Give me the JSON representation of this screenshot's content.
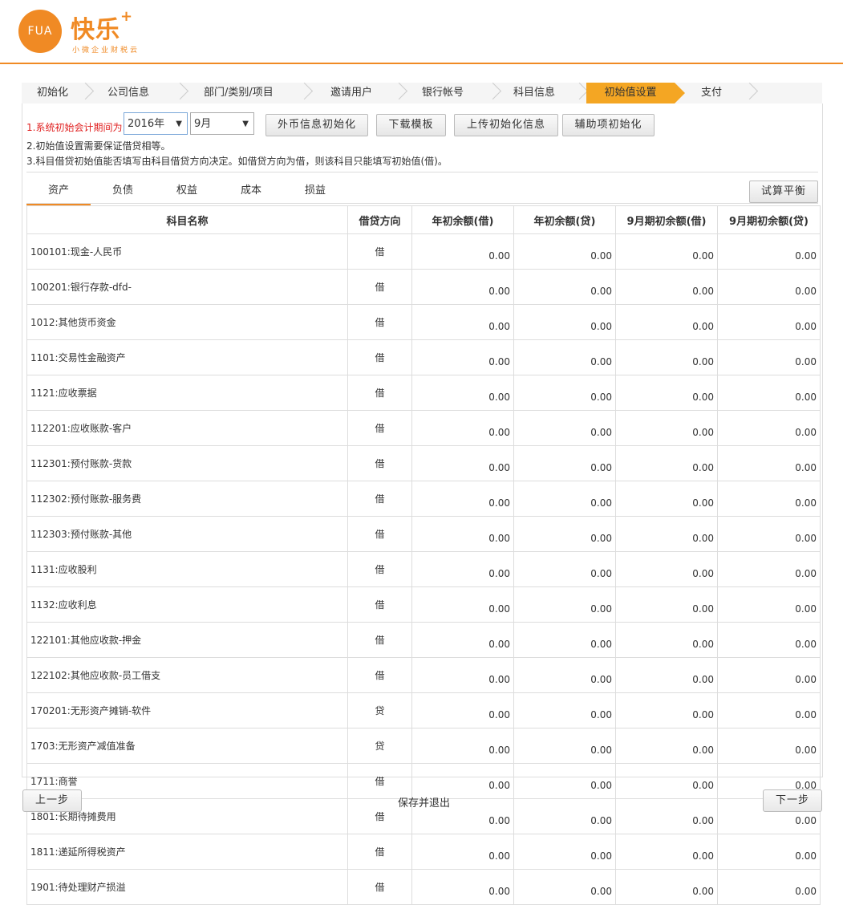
{
  "logo": {
    "circle_text": "FUA",
    "brand": "快乐",
    "plus": "+",
    "slogan": "小微企业财税云"
  },
  "steps": [
    "初始化",
    "公司信息",
    "部门/类别/项目",
    "邀请用户",
    "银行帐号",
    "科目信息",
    "初始值设置",
    "支付"
  ],
  "active_step": "初始值设置",
  "colors": {
    "accent": "#f08a24",
    "active_step": "#f4a623",
    "warning": "#e02020"
  },
  "notes": {
    "line1_label": "1.系统初始会计期间为:",
    "line2": "2.初始值设置需要保证借贷相等。",
    "line3": "3.科目借贷初始值能否填写由科目借贷方向决定。如借贷方向为借，则该科目只能填写初始值(借)。"
  },
  "period": {
    "year": "2016年",
    "month": "9月"
  },
  "buttons": {
    "fx_init": "外币信息初始化",
    "download_template": "下载模板",
    "upload_init": "上传初始化信息",
    "aux_init": "辅助项初始化",
    "trial_balance": "试算平衡",
    "prev": "上一步",
    "save_exit": "保存并退出",
    "next": "下一步"
  },
  "tabs": [
    "资产",
    "负债",
    "权益",
    "成本",
    "损益"
  ],
  "active_tab": "资产",
  "table": {
    "headers": [
      "科目名称",
      "借贷方向",
      "年初余额(借)",
      "年初余额(贷)",
      "9月期初余额(借)",
      "9月期初余额(贷)"
    ],
    "rows": [
      {
        "name": "100101:现金-人民币",
        "dir": "借",
        "v": [
          "0.00",
          "0.00",
          "0.00",
          "0.00"
        ]
      },
      {
        "name": "100201:银行存款-dfd-",
        "dir": "借",
        "v": [
          "0.00",
          "0.00",
          "0.00",
          "0.00"
        ]
      },
      {
        "name": "1012:其他货币资金",
        "dir": "借",
        "v": [
          "0.00",
          "0.00",
          "0.00",
          "0.00"
        ]
      },
      {
        "name": "1101:交易性金融资产",
        "dir": "借",
        "v": [
          "0.00",
          "0.00",
          "0.00",
          "0.00"
        ]
      },
      {
        "name": "1121:应收票据",
        "dir": "借",
        "v": [
          "0.00",
          "0.00",
          "0.00",
          "0.00"
        ]
      },
      {
        "name": "112201:应收账款-客户",
        "dir": "借",
        "v": [
          "0.00",
          "0.00",
          "0.00",
          "0.00"
        ]
      },
      {
        "name": "112301:预付账款-货款",
        "dir": "借",
        "v": [
          "0.00",
          "0.00",
          "0.00",
          "0.00"
        ]
      },
      {
        "name": "112302:预付账款-服务费",
        "dir": "借",
        "v": [
          "0.00",
          "0.00",
          "0.00",
          "0.00"
        ]
      },
      {
        "name": "112303:预付账款-其他",
        "dir": "借",
        "v": [
          "0.00",
          "0.00",
          "0.00",
          "0.00"
        ]
      },
      {
        "name": "1131:应收股利",
        "dir": "借",
        "v": [
          "0.00",
          "0.00",
          "0.00",
          "0.00"
        ]
      },
      {
        "name": "1132:应收利息",
        "dir": "借",
        "v": [
          "0.00",
          "0.00",
          "0.00",
          "0.00"
        ]
      },
      {
        "name": "122101:其他应收款-押金",
        "dir": "借",
        "v": [
          "0.00",
          "0.00",
          "0.00",
          "0.00"
        ]
      },
      {
        "name": "122102:其他应收款-员工借支",
        "dir": "借",
        "v": [
          "0.00",
          "0.00",
          "0.00",
          "0.00"
        ]
      },
      {
        "name": "170201:无形资产摊销-软件",
        "dir": "贷",
        "v": [
          "0.00",
          "0.00",
          "0.00",
          "0.00"
        ]
      },
      {
        "name": "1703:无形资产减值准备",
        "dir": "贷",
        "v": [
          "0.00",
          "0.00",
          "0.00",
          "0.00"
        ]
      },
      {
        "name": "1711:商誉",
        "dir": "借",
        "v": [
          "0.00",
          "0.00",
          "0.00",
          "0.00"
        ]
      },
      {
        "name": "1801:长期待摊费用",
        "dir": "借",
        "v": [
          "0.00",
          "0.00",
          "0.00",
          "0.00"
        ]
      },
      {
        "name": "1811:递延所得税资产",
        "dir": "借",
        "v": [
          "0.00",
          "0.00",
          "0.00",
          "0.00"
        ]
      },
      {
        "name": "1901:待处理财产损溢",
        "dir": "借",
        "v": [
          "0.00",
          "0.00",
          "0.00",
          "0.00"
        ]
      }
    ]
  }
}
